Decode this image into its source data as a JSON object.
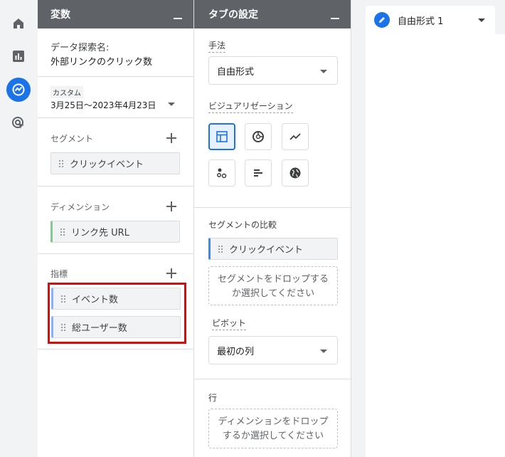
{
  "variables_panel": {
    "header": "変数",
    "exploration_name_label": "データ探索名:",
    "exploration_name": "外部リンクのクリック数",
    "date_badge": "カスタム",
    "date_range": "3月25日～2023年4月23日",
    "segments": {
      "label": "セグメント",
      "items": [
        "クリックイベント"
      ]
    },
    "dimensions": {
      "label": "ディメンション",
      "items": [
        "リンク先 URL"
      ]
    },
    "metrics": {
      "label": "指標",
      "items": [
        "イベント数",
        "総ユーザー数"
      ]
    }
  },
  "tab_settings_panel": {
    "header": "タブの設定",
    "technique_label": "手法",
    "technique_value": "自由形式",
    "visualization_label": "ビジュアリゼーション",
    "visualization_icons": [
      "table-icon",
      "donut-chart-icon",
      "line-chart-icon",
      "scatter-icon",
      "bar-chart-icon",
      "geo-map-icon"
    ],
    "segment_compare_label": "セグメントの比較",
    "segment_compare_item": "クリックイベント",
    "segment_drop_text": "セグメントをドロップする\nか選択してください",
    "pivot_label": "ピボット",
    "pivot_value": "最初の列",
    "rows_label": "行",
    "rows_drop_text": "ディメンションをドロップ\nするか選択してください"
  },
  "canvas": {
    "tab_name": "自由形式 1"
  },
  "colors": {
    "accent": "#1a73e8",
    "highlight": "#d20f0f",
    "header": "#5f6368"
  }
}
